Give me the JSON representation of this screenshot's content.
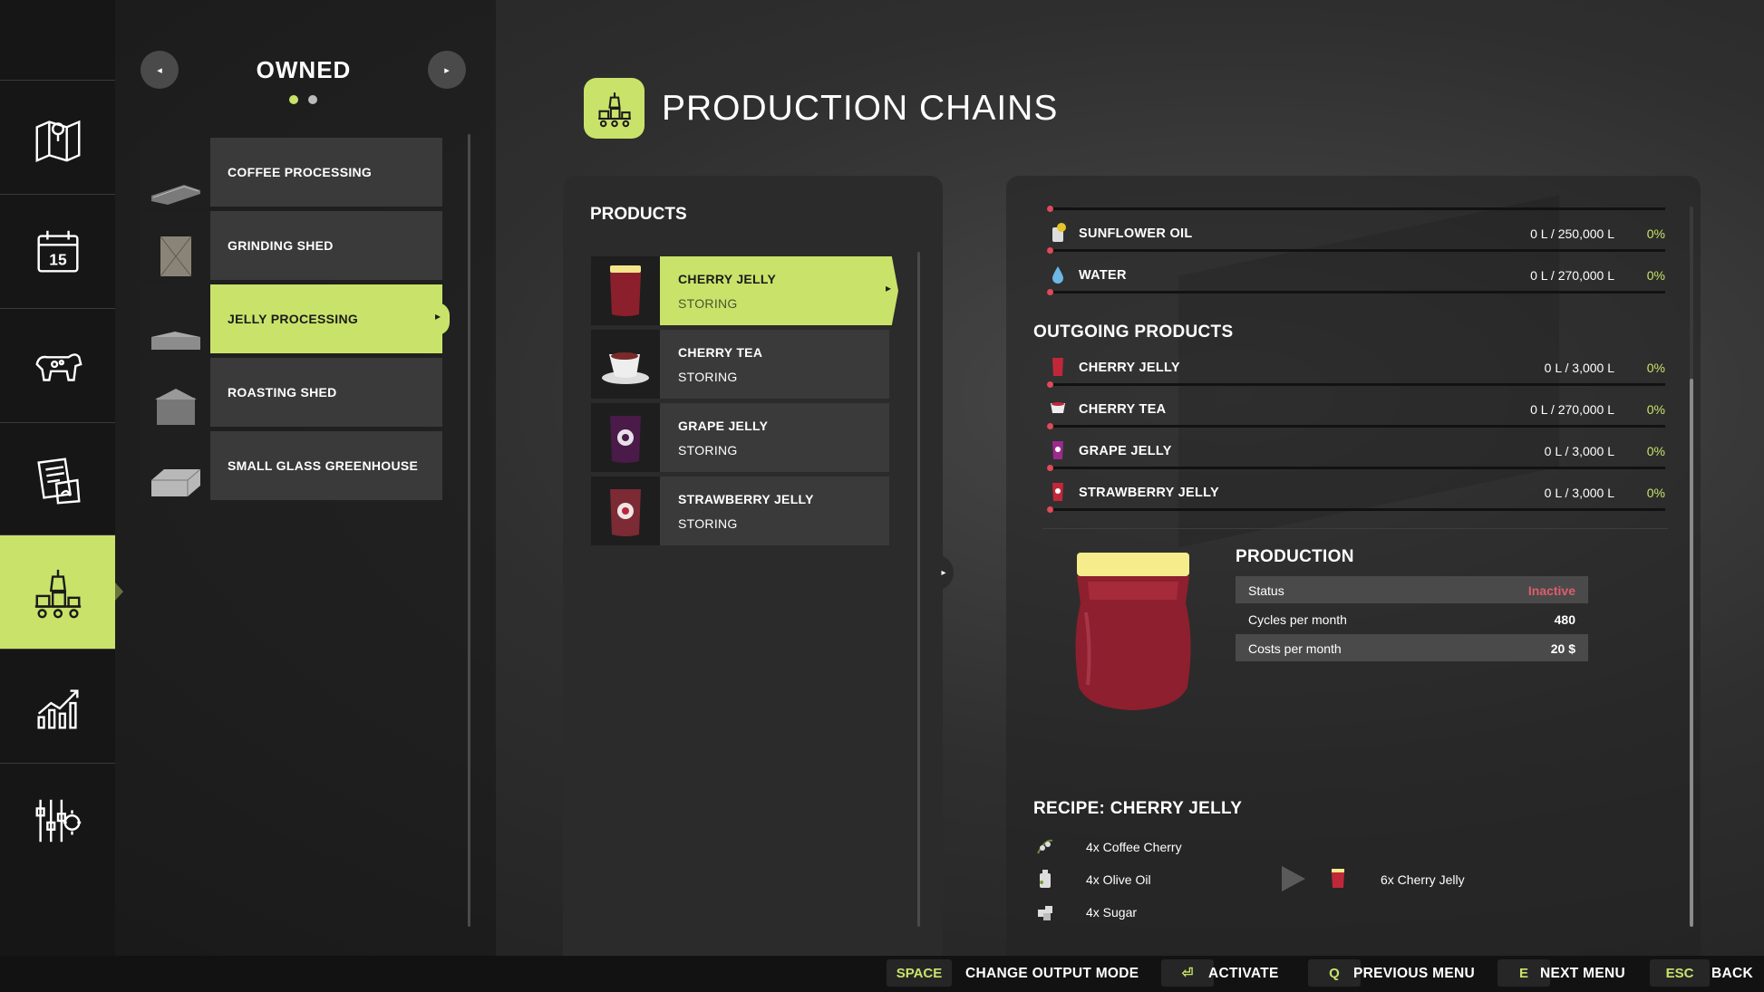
{
  "sidebar": {
    "items": [
      {
        "icon": "map-icon"
      },
      {
        "icon": "calendar-icon",
        "badge": "15"
      },
      {
        "icon": "cow-icon"
      },
      {
        "icon": "contracts-icon"
      },
      {
        "icon": "production-icon",
        "active": true
      },
      {
        "icon": "statistics-icon"
      },
      {
        "icon": "settings-icon"
      }
    ]
  },
  "owned": {
    "title": "OWNED",
    "prev_icon": "◂",
    "next_icon": "▸",
    "facilities": [
      {
        "label": "COFFEE PROCESSING"
      },
      {
        "label": "GRINDING SHED"
      },
      {
        "label": "JELLY PROCESSING",
        "active": true
      },
      {
        "label": "ROASTING SHED"
      },
      {
        "label": "SMALL GLASS GREENHOUSE"
      }
    ]
  },
  "header": {
    "title": "PRODUCTION CHAINS"
  },
  "products": {
    "title": "PRODUCTS",
    "items": [
      {
        "name": "CHERRY JELLY",
        "status": "STORING",
        "active": true
      },
      {
        "name": "CHERRY TEA",
        "status": "STORING"
      },
      {
        "name": "GRAPE JELLY",
        "status": "STORING"
      },
      {
        "name": "STRAWBERRY JELLY",
        "status": "STORING"
      }
    ]
  },
  "incoming": [
    {
      "name": "SUNFLOWER OIL",
      "amount": "0 L / 250,000 L",
      "pct": "0%"
    },
    {
      "name": "WATER",
      "amount": "0 L / 270,000 L",
      "pct": "0%"
    }
  ],
  "outgoing": {
    "title": "OUTGOING PRODUCTS",
    "items": [
      {
        "name": "CHERRY JELLY",
        "amount": "0 L / 3,000 L",
        "pct": "0%"
      },
      {
        "name": "CHERRY TEA",
        "amount": "0 L / 270,000 L",
        "pct": "0%"
      },
      {
        "name": "GRAPE JELLY",
        "amount": "0 L / 3,000 L",
        "pct": "0%"
      },
      {
        "name": "STRAWBERRY JELLY",
        "amount": "0 L / 3,000 L",
        "pct": "0%"
      }
    ]
  },
  "production": {
    "title": "PRODUCTION",
    "status_label": "Status",
    "status_value": "Inactive",
    "cycles_label": "Cycles per month",
    "cycles_value": "480",
    "costs_label": "Costs per month",
    "costs_value": "20 $"
  },
  "recipe": {
    "title": "RECIPE: CHERRY JELLY",
    "inputs": [
      "4x Coffee Cherry",
      "4x Olive Oil",
      "4x Sugar"
    ],
    "output": "6x Cherry Jelly"
  },
  "footer": {
    "keys": [
      {
        "key": "SPACE",
        "label": "CHANGE OUTPUT MODE"
      },
      {
        "key": "⏎",
        "label": "ACTIVATE"
      },
      {
        "key": "Q",
        "label": "PREVIOUS MENU"
      },
      {
        "key": "E",
        "label": "NEXT MENU"
      },
      {
        "key": "ESC",
        "label": "BACK"
      }
    ]
  },
  "colors": {
    "accent": "#c9e36a",
    "inactive": "#e05c6c",
    "fill_marker": "#e04a5a"
  }
}
